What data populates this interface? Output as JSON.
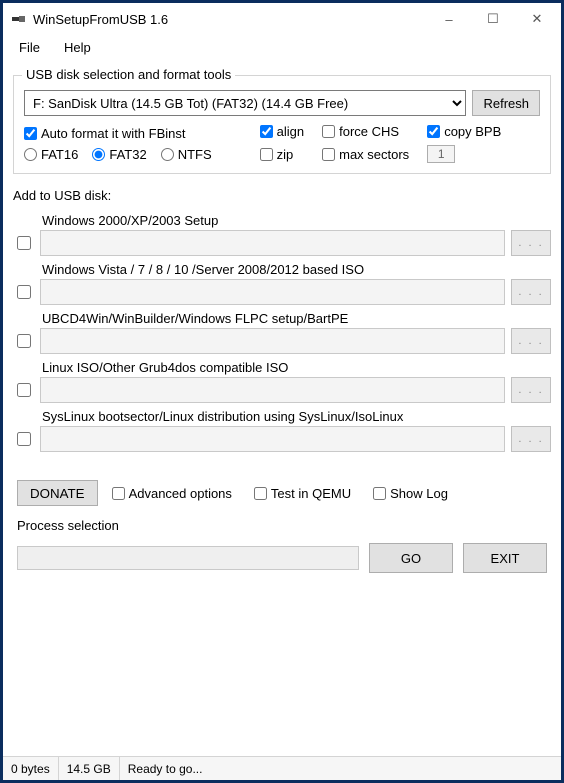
{
  "window": {
    "title": "WinSetupFromUSB 1.6",
    "minimize": "–",
    "maximize": "☐",
    "close": "✕"
  },
  "menu": {
    "file": "File",
    "help": "Help"
  },
  "usbGroup": {
    "label": "USB disk selection and format tools",
    "selectedDisk": "F: SanDisk Ultra (14.5 GB Tot) (FAT32) (14.4 GB Free)",
    "refresh": "Refresh",
    "autoFormatLabel": "Auto format it with FBinst",
    "autoFormatChecked": true,
    "fs": {
      "fat16": "FAT16",
      "fat32": "FAT32",
      "ntfs": "NTFS",
      "selected": "fat32"
    },
    "opts": {
      "align": {
        "label": "align",
        "checked": true
      },
      "forceCHS": {
        "label": "force CHS",
        "checked": false
      },
      "copyBPB": {
        "label": "copy BPB",
        "checked": true
      },
      "zip": {
        "label": "zip",
        "checked": false
      },
      "maxSectors": {
        "label": "max sectors",
        "checked": false,
        "value": "1"
      }
    }
  },
  "addSection": {
    "label": "Add to USB disk:",
    "items": [
      {
        "title": "Windows 2000/XP/2003 Setup"
      },
      {
        "title": "Windows Vista / 7 / 8 / 10 /Server 2008/2012 based ISO"
      },
      {
        "title": "UBCD4Win/WinBuilder/Windows FLPC setup/BartPE"
      },
      {
        "title": "Linux ISO/Other Grub4dos compatible ISO"
      },
      {
        "title": "SysLinux bootsector/Linux distribution using SysLinux/IsoLinux"
      }
    ],
    "browseText": ". . ."
  },
  "options": {
    "donate": "DONATE",
    "advanced": "Advanced options",
    "testQemu": "Test in QEMU",
    "showLog": "Show Log"
  },
  "process": {
    "label": "Process selection",
    "go": "GO",
    "exit": "EXIT"
  },
  "status": {
    "bytes": "0 bytes",
    "size": "14.5 GB",
    "text": "Ready to go..."
  }
}
